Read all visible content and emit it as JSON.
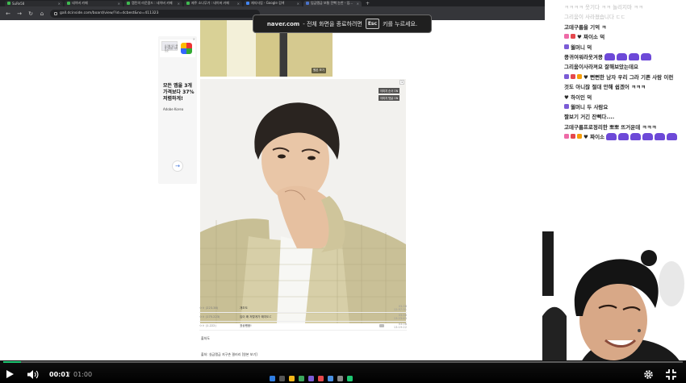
{
  "browser": {
    "tabs": [
      {
        "label": "SuRe58",
        "active": false
      },
      {
        "label": "네이버 카페",
        "active": false
      },
      {
        "label": "캡틴의 라운콤드 : 네이버 카페",
        "active": false
      },
      {
        "label": "제주 소나무가 : 네이버 카페",
        "active": false
      },
      {
        "label": "재지사업 - Google 검색",
        "active": false
      },
      {
        "label": "입금맹금 보통 잔뻑 눈찬 - 입…",
        "active": true
      }
    ],
    "url": "gall.dcinside.com/board/view/?id=dcbest&no=411323",
    "new_tab": "+",
    "window_controls": [
      "—",
      "❐",
      "✕"
    ]
  },
  "fullscreen_notice": {
    "domain": "naver.com",
    "before": "- 전체 화면을 종료하려면",
    "key": "Esc",
    "after": "키를 누르세요."
  },
  "ad": {
    "image_text": "요금제 모든 앱을 할인된 가격으로",
    "headline": "모든 앱을 3개 가격보다 37% 저렴하게!",
    "brand": "Adobe Korea",
    "close": "×",
    "arrow": "→"
  },
  "post": {
    "tag_original": "원본 보기",
    "image_tags": [
      "이미지 순서 ON",
      "이미지 댓글 ON"
    ],
    "image_badge": "1",
    "comments": [
      {
        "user": "ㅇㅇ",
        "ip": "(223.38)",
        "text": "개조도",
        "time": "03.08 12:57:31"
      },
      {
        "user": "ㅇㅇ",
        "ip": "(175.223)",
        "text": "입이 왜 저렇게가 돼지도ㄷ",
        "time": "03.08 13:23:43"
      },
      {
        "user": "ㅇㅇ",
        "ip": "(1.222)",
        "text": "표상했음!",
        "time": "03.08 13:19:22"
      }
    ],
    "body_line1": "출처도",
    "body_line2": "출처: 실금맹금 지구촌 갤러리 [원본 보기]"
  },
  "chat": {
    "lines": [
      {
        "text": "ㅋㅋㅋㅋ 웃기다 ㅋㅋ 놀리지마 ㅋㅋ",
        "faded": true,
        "badges": [],
        "emotes": 0
      },
      {
        "text": "그리움이 사라졌습니다 ㄷㄷ",
        "faded": true,
        "badges": [],
        "emotes": 0
      },
      {
        "text": "고데구름을 기억 ㅋ",
        "faded": false,
        "badges": [],
        "emotes": 0
      },
      {
        "text": "♥ 짜이소 덕",
        "faded": false,
        "badges": [
          "b-pink",
          "b-red"
        ],
        "emotes": 0
      },
      {
        "text": "월머니 덕",
        "faded": false,
        "badges": [
          "b-purple"
        ],
        "emotes": 0
      },
      {
        "text": "콩귀여워라웃겨콩",
        "faded": false,
        "badges": [],
        "emotes": 4
      },
      {
        "text": "그리움이사라져요 잘해보았는데요",
        "faded": false,
        "badges": [],
        "emotes": 0
      },
      {
        "text": "♥ 뻔뻔한 남자 우리 그라 기쁜 사람 이런",
        "faded": false,
        "badges": [
          "b-purple",
          "b-red",
          "b-orange"
        ],
        "emotes": 0
      },
      {
        "text": "것도 아니잖 절대 안해 쉽겠어 ㅋㅋㅋ",
        "faded": false,
        "badges": [],
        "emotes": 0
      },
      {
        "text": "♥ 하이인 덕",
        "faded": false,
        "badges": [],
        "emotes": 0
      },
      {
        "text": "월머니 두 사람요",
        "faded": false,
        "badges": [
          "b-purple"
        ],
        "emotes": 0
      },
      {
        "text": "짤보기 거긴 잔뻑다....",
        "faded": false,
        "badges": [],
        "emotes": 0
      },
      {
        "text": "고데구름프로정리한 뽀뽀 뜨거운데 ㅋㅋㅋ",
        "faded": false,
        "badges": [],
        "emotes": 0
      },
      {
        "text": "♥ 짜이소",
        "faded": false,
        "badges": [
          "b-pink",
          "b-red",
          "b-orange"
        ],
        "emotes": 6
      }
    ]
  },
  "player": {
    "current_time": "00:01",
    "separator": "/",
    "total_time": "01:00",
    "progress": 0.026
  }
}
